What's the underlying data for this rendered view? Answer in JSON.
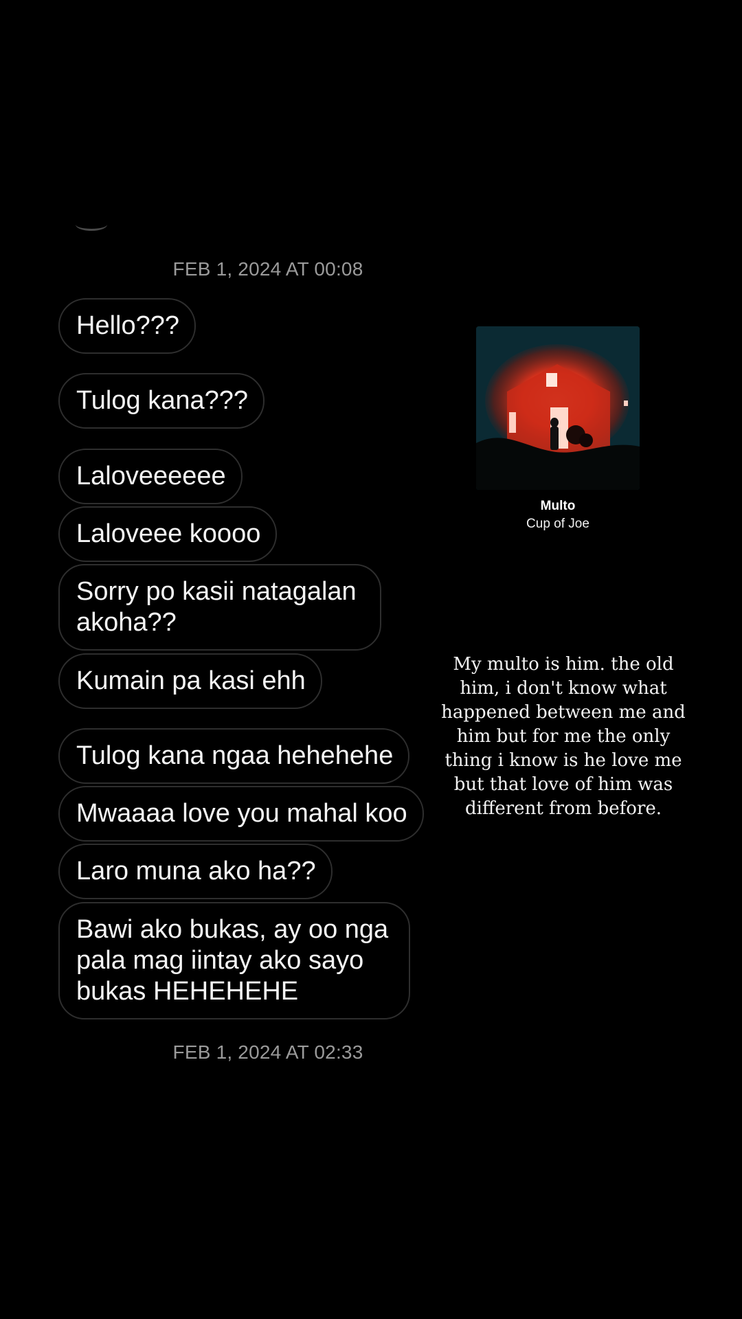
{
  "conversation": {
    "timestamp_top": "FEB 1, 2024 AT 00:08",
    "timestamp_bottom": "FEB 1, 2024 AT 02:33",
    "messages": [
      "Hello???",
      "Tulog kana???",
      "Laloveeeeee",
      "Laloveee koooo",
      "Sorry po kasii natagalan akoha??",
      "Kumain pa kasi ehh",
      "Tulog kana ngaa hehehehe",
      "Mwaaaa love you mahal koo",
      "Laro muna ako ha??",
      "Bawi ako bukas, ay oo nga pala mag iintay ako sayo bukas HEHEHEHE"
    ]
  },
  "music_sticker": {
    "title": "Multo",
    "artist": "Cup of Joe",
    "art_icon": "house-glow-icon"
  },
  "caption": "My multo is him. the old him, i don't know what happened between me and him but for me the only thing i know is he love me but that love of him was different from before.",
  "colors": {
    "background": "#000000",
    "bubble_border": "#2e2e2e",
    "timestamp": "#9a9a9a",
    "album_bg": "#0b2a33",
    "album_glow": "#e8341c"
  }
}
